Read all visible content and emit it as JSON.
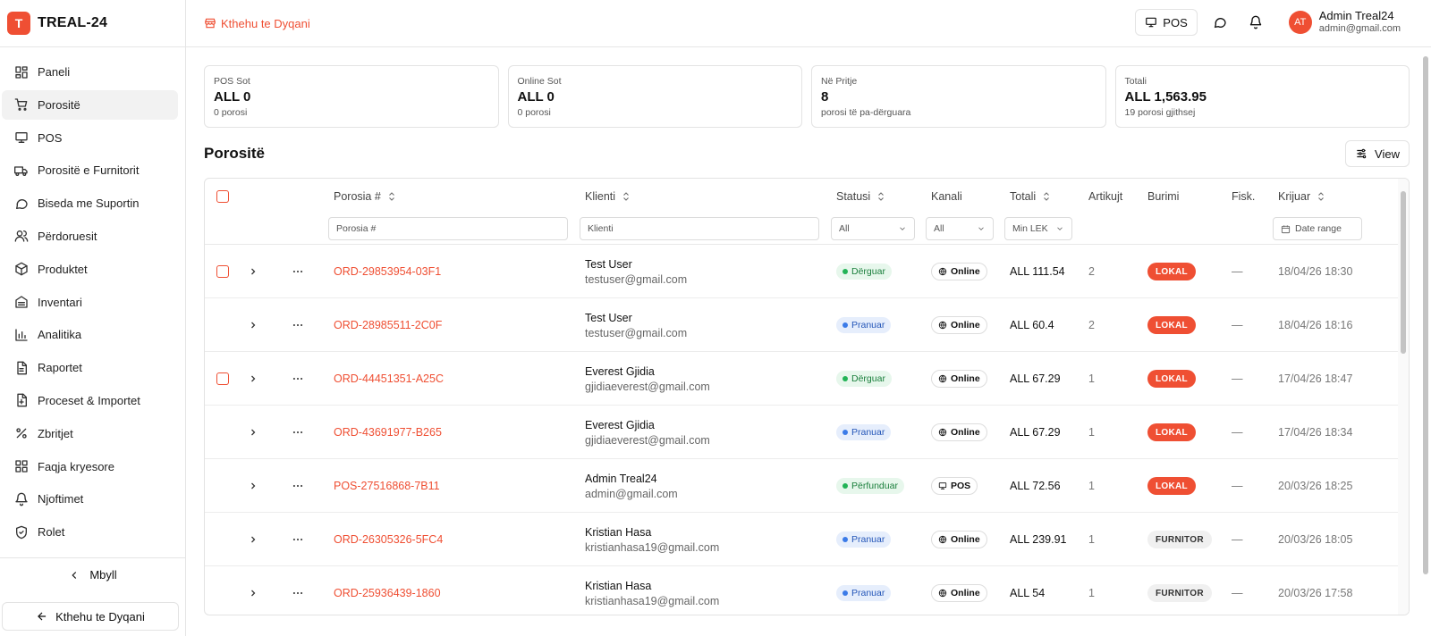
{
  "brand": {
    "logo_letter": "T",
    "name": "TREAL-24"
  },
  "sidebar": {
    "items": [
      {
        "label": "Paneli",
        "icon": "dashboard-icon"
      },
      {
        "label": "Porositë",
        "icon": "cart-icon",
        "active": true
      },
      {
        "label": "POS",
        "icon": "monitor-icon"
      },
      {
        "label": "Porositë e Furnitorit",
        "icon": "truck-icon"
      },
      {
        "label": "Biseda me Suportin",
        "icon": "chat-icon"
      },
      {
        "label": "Përdoruesit",
        "icon": "users-icon"
      },
      {
        "label": "Produktet",
        "icon": "package-icon"
      },
      {
        "label": "Inventari",
        "icon": "warehouse-icon"
      },
      {
        "label": "Analitika",
        "icon": "chart-icon"
      },
      {
        "label": "Raportet",
        "icon": "report-icon"
      },
      {
        "label": "Proceset & Importet",
        "icon": "import-icon"
      },
      {
        "label": "Zbritjet",
        "icon": "percent-icon"
      },
      {
        "label": "Faqja kryesore",
        "icon": "grid-icon"
      },
      {
        "label": "Njoftimet",
        "icon": "bell-icon"
      },
      {
        "label": "Rolet",
        "icon": "shield-icon"
      }
    ],
    "collapse_label": "Mbyll",
    "back_label": "Kthehu te Dyqani"
  },
  "topbar": {
    "back_link": "Kthehu te Dyqani",
    "pos_label": "POS",
    "user": {
      "initials": "AT",
      "name": "Admin Treal24",
      "email": "admin@gmail.com"
    }
  },
  "stats": [
    {
      "label": "POS Sot",
      "value": "ALL 0",
      "sub": "0 porosi"
    },
    {
      "label": "Online Sot",
      "value": "ALL 0",
      "sub": "0 porosi"
    },
    {
      "label": "Në Pritje",
      "value": "8",
      "sub": "porosi të pa-dërguara"
    },
    {
      "label": "Totali",
      "value": "ALL 1,563.95",
      "sub": "19 porosi gjithsej"
    }
  ],
  "section": {
    "title": "Porositë",
    "view_label": "View"
  },
  "table": {
    "columns": {
      "order": "Porosia #",
      "client": "Klienti",
      "status": "Statusi",
      "channel": "Kanali",
      "total": "Totali",
      "items": "Artikujt",
      "source": "Burimi",
      "fisk": "Fisk.",
      "created": "Krijuar"
    },
    "filters": {
      "order_placeholder": "Porosia #",
      "client_placeholder": "Klienti",
      "status_value": "All",
      "channel_value": "All",
      "total_placeholder": "Min LEK",
      "date_placeholder": "Date range"
    },
    "rows": [
      {
        "id": "ORD-29853954-03F1",
        "name": "Test User",
        "email": "testuser@gmail.com",
        "status": "Dërguar",
        "status_color": "green",
        "channel": "Online",
        "total": "ALL 111.54",
        "items": "2",
        "source": "LOKAL",
        "fisk": "—",
        "created": "18/04/26 18:30",
        "checkbox": true
      },
      {
        "id": "ORD-28985511-2C0F",
        "name": "Test User",
        "email": "testuser@gmail.com",
        "status": "Pranuar",
        "status_color": "blue",
        "channel": "Online",
        "total": "ALL 60.4",
        "items": "2",
        "source": "LOKAL",
        "fisk": "—",
        "created": "18/04/26 18:16",
        "checkbox": false
      },
      {
        "id": "ORD-44451351-A25C",
        "name": "Everest Gjidia",
        "email": "gjidiaeverest@gmail.com",
        "status": "Dërguar",
        "status_color": "green",
        "channel": "Online",
        "total": "ALL 67.29",
        "items": "1",
        "source": "LOKAL",
        "fisk": "—",
        "created": "17/04/26 18:47",
        "checkbox": true
      },
      {
        "id": "ORD-43691977-B265",
        "name": "Everest Gjidia",
        "email": "gjidiaeverest@gmail.com",
        "status": "Pranuar",
        "status_color": "blue",
        "channel": "Online",
        "total": "ALL 67.29",
        "items": "1",
        "source": "LOKAL",
        "fisk": "—",
        "created": "17/04/26 18:34",
        "checkbox": false
      },
      {
        "id": "POS-27516868-7B11",
        "name": "Admin Treal24",
        "email": "admin@gmail.com",
        "status": "Përfunduar",
        "status_color": "green",
        "channel": "POS",
        "total": "ALL 72.56",
        "items": "1",
        "source": "LOKAL",
        "fisk": "—",
        "created": "20/03/26 18:25",
        "checkbox": false
      },
      {
        "id": "ORD-26305326-5FC4",
        "name": "Kristian Hasa",
        "email": "kristianhasa19@gmail.com",
        "status": "Pranuar",
        "status_color": "blue",
        "channel": "Online",
        "total": "ALL 239.91",
        "items": "1",
        "source": "FURNITOR",
        "fisk": "—",
        "created": "20/03/26 18:05",
        "checkbox": false
      },
      {
        "id": "ORD-25936439-1860",
        "name": "Kristian Hasa",
        "email": "kristianhasa19@gmail.com",
        "status": "Pranuar",
        "status_color": "blue",
        "channel": "Online",
        "total": "ALL 54",
        "items": "1",
        "source": "FURNITOR",
        "fisk": "—",
        "created": "20/03/26 17:58",
        "checkbox": false
      }
    ]
  }
}
